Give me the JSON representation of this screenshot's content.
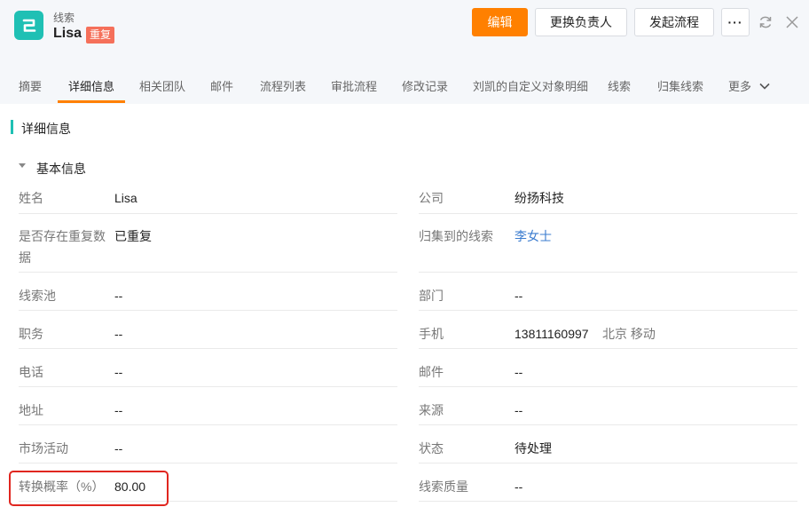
{
  "header": {
    "object_type": "线索",
    "record_name": "Lisa",
    "duplicate_badge": "重复",
    "buttons": {
      "edit": "编辑",
      "change_owner": "更换负责人",
      "start_flow": "发起流程",
      "more": "···"
    },
    "accent_color": "#ff8000",
    "brand_color": "#1fc0b4"
  },
  "tabs": [
    {
      "label": "摘要"
    },
    {
      "label": "详细信息",
      "active": true
    },
    {
      "label": "相关团队"
    },
    {
      "label": "邮件"
    },
    {
      "label": "流程列表"
    },
    {
      "label": "审批流程"
    },
    {
      "label": "修改记录"
    },
    {
      "label": "刘凯的自定义对象明细"
    },
    {
      "label": "线索"
    },
    {
      "label": "归集线索"
    },
    {
      "label": "更多"
    }
  ],
  "section": {
    "title": "详细信息",
    "subsection": "基本信息"
  },
  "fields": {
    "left": [
      {
        "label": "姓名",
        "value": "Lisa"
      },
      {
        "label": "是否存在重复数据",
        "label_line1": "是否存在重复数",
        "label_line2": "据",
        "value": "已重复"
      },
      {
        "label": "线索池",
        "value": "--"
      },
      {
        "label": "职务",
        "value": "--"
      },
      {
        "label": "电话",
        "value": "--"
      },
      {
        "label": "地址",
        "value": "--"
      },
      {
        "label": "市场活动",
        "value": "--"
      },
      {
        "label": "转换概率（%）",
        "value": "80.00"
      }
    ],
    "right": [
      {
        "label": "公司",
        "value": "纷扬科技"
      },
      {
        "label": "归集到的线索",
        "value": "李女士"
      },
      {
        "label": "部门",
        "value": "--"
      },
      {
        "label": "手机",
        "value": "13811160997",
        "extra": "北京 移动"
      },
      {
        "label": "邮件",
        "value": "--"
      },
      {
        "label": "来源",
        "value": "--"
      },
      {
        "label": "状态",
        "value": "待处理"
      },
      {
        "label": "线索质量",
        "value": "--"
      }
    ]
  }
}
